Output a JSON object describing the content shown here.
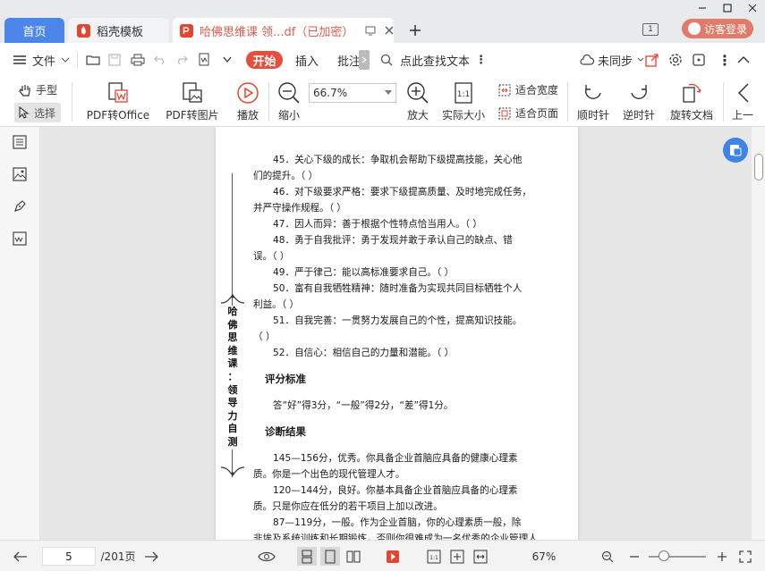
{
  "tabs": {
    "home": "首页",
    "template": "稻壳模板",
    "document": "哈佛思维课 领...df（已加密）"
  },
  "header": {
    "page_count_icon": "1",
    "login": "访客登录"
  },
  "menu": {
    "file": "文件",
    "start": "开始",
    "insert": "插入",
    "annotate": "批注",
    "search_placeholder": "点此查找文本",
    "sync": "未同步"
  },
  "toolbar": {
    "hand": "手型",
    "select": "选择",
    "pdf_to_office": "PDF转Office",
    "pdf_to_image": "PDF转图片",
    "play": "播放",
    "zoom_out": "缩小",
    "zoom_value": "66.7%",
    "zoom_in": "放大",
    "actual_size": "实际大小",
    "fit_width": "适合宽度",
    "fit_page": "适合页面",
    "rotate_cw": "顺时针",
    "rotate_ccw": "逆时针",
    "rotate_doc": "旋转文档",
    "prev": "上一"
  },
  "document": {
    "vertical_title": [
      "哈",
      "佛",
      "思",
      "维",
      "课",
      "：",
      "领",
      "导",
      "力",
      "自",
      "测"
    ],
    "lines": [
      "45．关心下级的成长：争取机会帮助下级提高技能，关心他",
      "们的提升。（  ）",
      "46．对下级要求严格：要求下级提高质量、及时地完成任务，",
      "并严守操作规程。（  ）",
      "47．因人而异：善于根据个性特点恰当用人。（  ）",
      "48．勇于自我批评：勇于发现并敢于承认自己的缺点、错",
      "误。（  ）",
      "49．严于律己：能以高标准要求自己。（  ）",
      "50．富有自我牺牲精神：随时准备为实现共同目标牺牲个人",
      "利益。（  ）",
      "51．自我完善：一贯努力发展自己的个性，提高知识技能。",
      "（  ）",
      "52．自信心：相信自己的力量和潜能。（  ）"
    ],
    "heading_scoring": "评分标准",
    "scoring_text": "答“好”得3分，“一般”得2分，“差”得1分。",
    "heading_diagnosis": "诊断结果",
    "diagnosis_lines": [
      "145—156分，优秀。你具备企业首脑应具备的健康心理素",
      "质。你是一个出色的现代管理人才。",
      "120—144分，良好。你基本具备企业首脑应具备的心理素",
      "质。只是你应在低分的若干项目上加以改进。",
      "87—119分，一般。作为企业首脑，你的心理素质一般，除",
      "非埃及系统训练和长期锻炼，否则你很难成为一名优秀的企业管理人"
    ]
  },
  "status": {
    "current_page": "5",
    "total_pages": "/201页",
    "zoom_percent": "67%"
  },
  "colors": {
    "accent_blue": "#4c86e8",
    "accent_red": "#e54d3c",
    "login_pink": "#e07a6a"
  }
}
